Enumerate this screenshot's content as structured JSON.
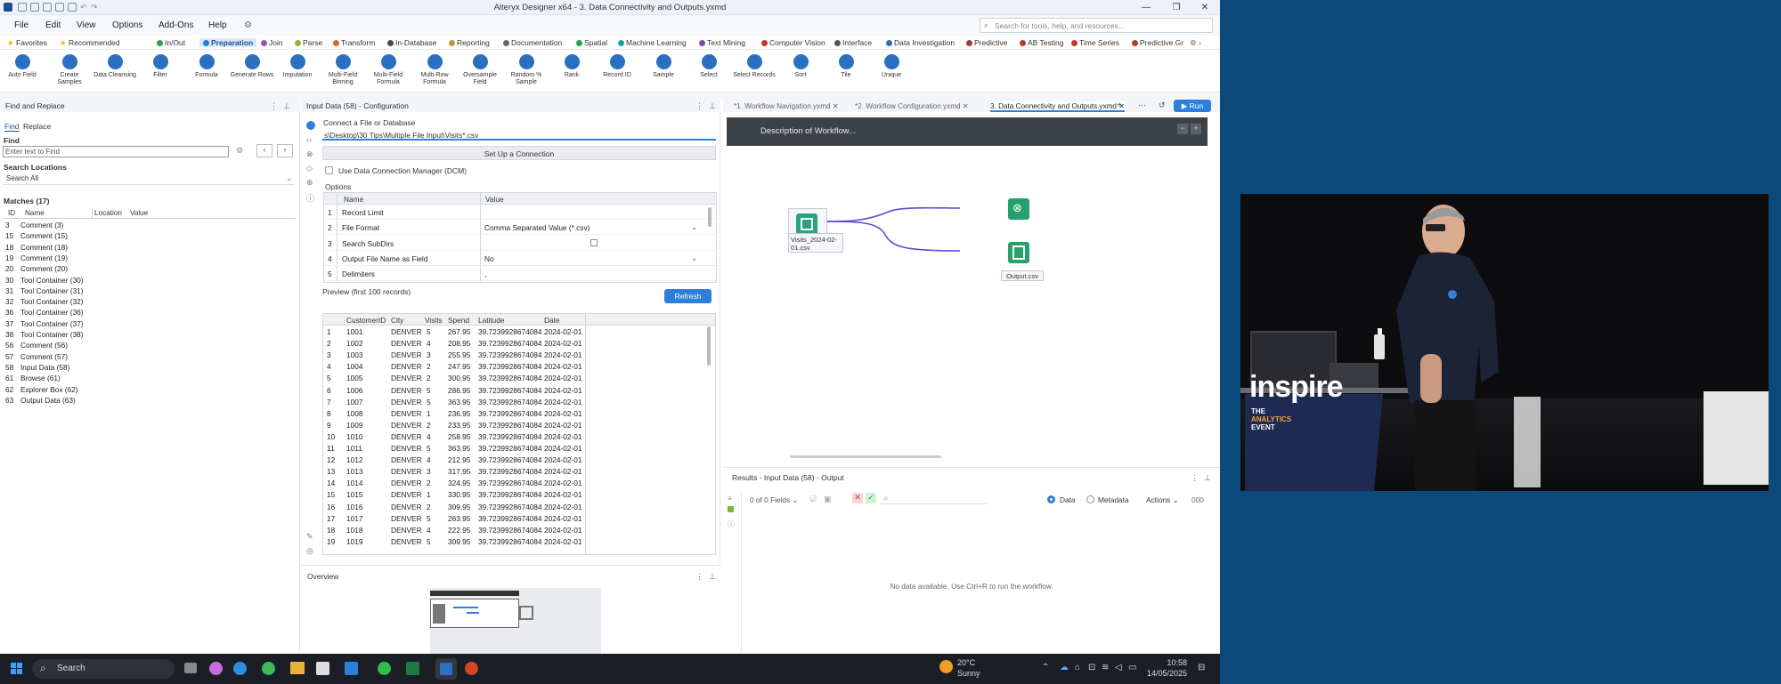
{
  "window": {
    "title": "Alteryx Designer x64 - 3. Data Connectivity and Outputs.yxmd",
    "controls": [
      "—",
      "❐",
      "✕"
    ]
  },
  "menu": {
    "items": [
      "File",
      "Edit",
      "View",
      "Options",
      "Add-Ons",
      "Help"
    ],
    "search_placeholder": "Search for tools, help, and resources..."
  },
  "categories": [
    {
      "label": "Favorites",
      "color": "#f0b400"
    },
    {
      "label": "Recommended",
      "color": "#f0b400"
    },
    {
      "label": "In/Out",
      "color": "#2aa34a"
    },
    {
      "label": "Preparation",
      "color": "#2a7fd4",
      "active": true
    },
    {
      "label": "Join",
      "color": "#8c5ab4"
    },
    {
      "label": "Parse",
      "color": "#8cb43c"
    },
    {
      "label": "Transform",
      "color": "#e0642a"
    },
    {
      "label": "In-Database",
      "color": "#4a4a4a"
    },
    {
      "label": "Reporting",
      "color": "#b4a03c"
    },
    {
      "label": "Documentation",
      "color": "#666666"
    },
    {
      "label": "Spatial",
      "color": "#2aa34a"
    },
    {
      "label": "Machine Learning",
      "color": "#1aa3a3"
    },
    {
      "label": "Text Mining",
      "color": "#7a4ab4"
    },
    {
      "label": "Computer Vision",
      "color": "#c0392b"
    },
    {
      "label": "Interface",
      "color": "#555555"
    },
    {
      "label": "Data Investigation",
      "color": "#3a6ab4"
    },
    {
      "label": "Predictive",
      "color": "#a03a3a"
    },
    {
      "label": "AB Testing",
      "color": "#c0392b"
    },
    {
      "label": "Time Series",
      "color": "#c0392b"
    },
    {
      "label": "Predictive Gr",
      "color": "#c0392b"
    }
  ],
  "tools": [
    "Auto Field",
    "Create Samples",
    "Data Cleansing",
    "Filter",
    "Formula",
    "Generate Rows",
    "Imputation",
    "Multi-Field Binning",
    "Multi-Field Formula",
    "Multi-Row Formula",
    "Oversample Field",
    "Random % Sample",
    "Rank",
    "Record ID",
    "Sample",
    "Select",
    "Select Records",
    "Sort",
    "Tile",
    "Unique"
  ],
  "find_replace": {
    "title": "Find and Replace",
    "tabs": [
      "Find",
      "Replace"
    ],
    "find_label": "Find",
    "find_placeholder": "Enter text to Find",
    "search_locations_label": "Search Locations",
    "search_locations_value": "Search All",
    "matches_label": "Matches (17)",
    "columns": [
      "ID",
      "Name",
      "Location",
      "Value"
    ],
    "rows": [
      {
        "id": "3",
        "name": "Comment (3)"
      },
      {
        "id": "15",
        "name": "Comment (15)"
      },
      {
        "id": "18",
        "name": "Comment (18)"
      },
      {
        "id": "19",
        "name": "Comment (19)"
      },
      {
        "id": "20",
        "name": "Comment (20)"
      },
      {
        "id": "30",
        "name": "Tool Container (30)"
      },
      {
        "id": "31",
        "name": "Tool Container (31)"
      },
      {
        "id": "32",
        "name": "Tool Container (32)"
      },
      {
        "id": "36",
        "name": "Tool Container (36)"
      },
      {
        "id": "37",
        "name": "Tool Container (37)"
      },
      {
        "id": "38",
        "name": "Tool Container (38)"
      },
      {
        "id": "56",
        "name": "Comment (56)"
      },
      {
        "id": "57",
        "name": "Comment (57)"
      },
      {
        "id": "58",
        "name": "Input Data (58)"
      },
      {
        "id": "61",
        "name": "Browse (61)"
      },
      {
        "id": "62",
        "name": "Explorer Box (62)"
      },
      {
        "id": "63",
        "name": "Output Data (63)"
      }
    ]
  },
  "config": {
    "title": "Input Data (58) - Configuration",
    "connect_label": "Connect a File or Database",
    "path_value": "s\\Desktop\\30 Tips\\Multiple File Input\\Visits*.csv",
    "setup_button": "Set Up a Connection",
    "dcm_label": "Use Data Connection Manager (DCM)",
    "options_label": "Options",
    "options_cols": [
      "Name",
      "Value"
    ],
    "options": [
      {
        "n": "1",
        "name": "Record Limit",
        "value": ""
      },
      {
        "n": "2",
        "name": "File Format",
        "value": "Comma Separated Value (*.csv)"
      },
      {
        "n": "3",
        "name": "Search SubDirs",
        "value": ""
      },
      {
        "n": "4",
        "name": "Output File Name as Field",
        "value": "No"
      },
      {
        "n": "5",
        "name": "Delimiters",
        "value": ","
      }
    ],
    "preview_label": "Preview (first 100 records)",
    "refresh_button": "Refresh",
    "preview_cols": [
      "CustomerID",
      "City",
      "Visits",
      "Spend",
      "Latitude",
      "Date"
    ],
    "preview_rows": [
      [
        "1",
        "1001",
        "DENVER",
        "5",
        "267.95",
        "39.7239928674084",
        "2024-02-01"
      ],
      [
        "2",
        "1002",
        "DENVER",
        "4",
        "208.95",
        "39.7239928674084",
        "2024-02-01"
      ],
      [
        "3",
        "1003",
        "DENVER",
        "3",
        "255.95",
        "39.7239928674084",
        "2024-02-01"
      ],
      [
        "4",
        "1004",
        "DENVER",
        "2",
        "247.95",
        "39.7239928674084",
        "2024-02-01"
      ],
      [
        "5",
        "1005",
        "DENVER",
        "2",
        "300.95",
        "39.7239928674084",
        "2024-02-01"
      ],
      [
        "6",
        "1006",
        "DENVER",
        "5",
        "286.95",
        "39.7239928674084",
        "2024-02-01"
      ],
      [
        "7",
        "1007",
        "DENVER",
        "5",
        "363.95",
        "39.7239928674084",
        "2024-02-01"
      ],
      [
        "8",
        "1008",
        "DENVER",
        "1",
        "236.95",
        "39.7239928674084",
        "2024-02-01"
      ],
      [
        "9",
        "1009",
        "DENVER",
        "2",
        "233.95",
        "39.7239928674084",
        "2024-02-01"
      ],
      [
        "10",
        "1010",
        "DENVER",
        "4",
        "258.95",
        "39.7239928674084",
        "2024-02-01"
      ],
      [
        "11",
        "1011",
        "DENVER",
        "5",
        "363.95",
        "39.7239928674084",
        "2024-02-01"
      ],
      [
        "12",
        "1012",
        "DENVER",
        "4",
        "212.95",
        "39.7239928674084",
        "2024-02-01"
      ],
      [
        "13",
        "1013",
        "DENVER",
        "3",
        "317.95",
        "39.7239928674084",
        "2024-02-01"
      ],
      [
        "14",
        "1014",
        "DENVER",
        "2",
        "324.95",
        "39.7239928674084",
        "2024-02-01"
      ],
      [
        "15",
        "1015",
        "DENVER",
        "1",
        "330.95",
        "39.7239928674084",
        "2024-02-01"
      ],
      [
        "16",
        "1016",
        "DENVER",
        "2",
        "309.95",
        "39.7239928674084",
        "2024-02-01"
      ],
      [
        "17",
        "1017",
        "DENVER",
        "5",
        "263.95",
        "39.7239928674084",
        "2024-02-01"
      ],
      [
        "18",
        "1018",
        "DENVER",
        "4",
        "222.95",
        "39.7239928674084",
        "2024-02-01"
      ],
      [
        "19",
        "1019",
        "DENVER",
        "5",
        "309.95",
        "39.7239928674084",
        "2024-02-01"
      ]
    ]
  },
  "overview": {
    "title": "Overview"
  },
  "canvas": {
    "tabs": [
      "*1. Workflow Navigation.yxmd",
      "*2. Workflow Configuration.yxmd",
      "3. Data Connectivity and Outputs.yxmd"
    ],
    "run_button": "Run",
    "description": "Description of Workflow...",
    "input_label": "Visits_2024-02-01.csv",
    "output_label": "Output.csv"
  },
  "results": {
    "title": "Results - Input Data (58) - Output",
    "fields": "0 of 0 Fields",
    "data_label": "Data",
    "metadata_label": "Metadata",
    "actions_label": "Actions",
    "empty_message": "No data available. Use Ctrl+R to run the workflow."
  },
  "taskbar": {
    "search": "Search",
    "weather_temp": "20°C",
    "weather_desc": "Sunny",
    "time": "10:58",
    "date": "14/05/2025"
  },
  "video": {
    "logo_main": "inspire",
    "logo_sub1": "THE",
    "logo_sub2": "ANALYTICS",
    "logo_sub3": "EVENT"
  }
}
